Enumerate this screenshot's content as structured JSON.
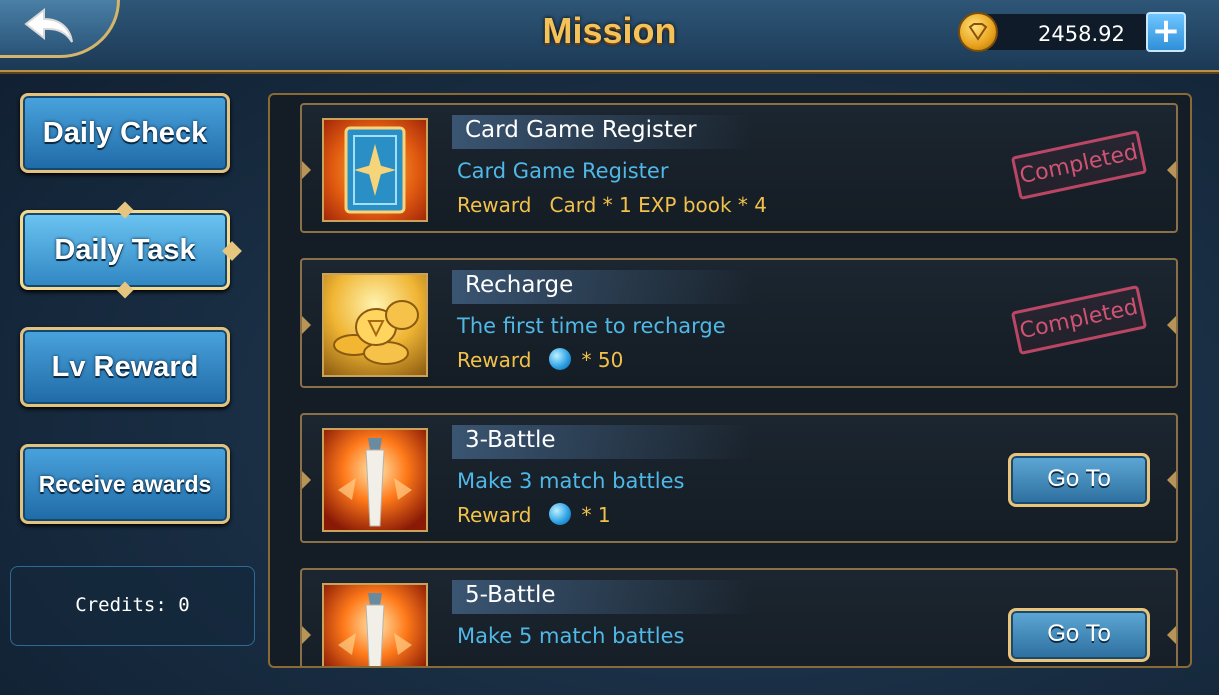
{
  "header": {
    "title": "Mission",
    "balance": "2458.92",
    "plus_label": "+"
  },
  "sidebar": {
    "items": [
      {
        "label": "Daily Check"
      },
      {
        "label": "Daily Task"
      },
      {
        "label": "Lv Reward"
      },
      {
        "label": "Receive awards"
      }
    ],
    "credits": "Credits: 0"
  },
  "tasks": [
    {
      "name": "Card Game Register",
      "description": "Card Game Register",
      "reward_label": "Reward",
      "reward_text": "Card * 1 EXP book * 4",
      "status": "Completed",
      "icon": "card-icon"
    },
    {
      "name": "Recharge",
      "description": "The first time to recharge",
      "reward_label": "Reward",
      "reward_text": "* 50",
      "status": "Completed",
      "icon": "coins-icon"
    },
    {
      "name": "3-Battle",
      "description": "Make 3 match battles",
      "reward_label": "Reward",
      "reward_text": "* 1",
      "action": "Go To",
      "icon": "sword-icon"
    },
    {
      "name": "5-Battle",
      "description": "Make 5 match battles",
      "action": "Go To",
      "icon": "sword-icon"
    }
  ],
  "colors": {
    "title_gold": "#f3c25a",
    "desc_blue": "#4fb8e6",
    "reward_gold": "#f2c14b",
    "stamp_pink": "#e0587a"
  }
}
